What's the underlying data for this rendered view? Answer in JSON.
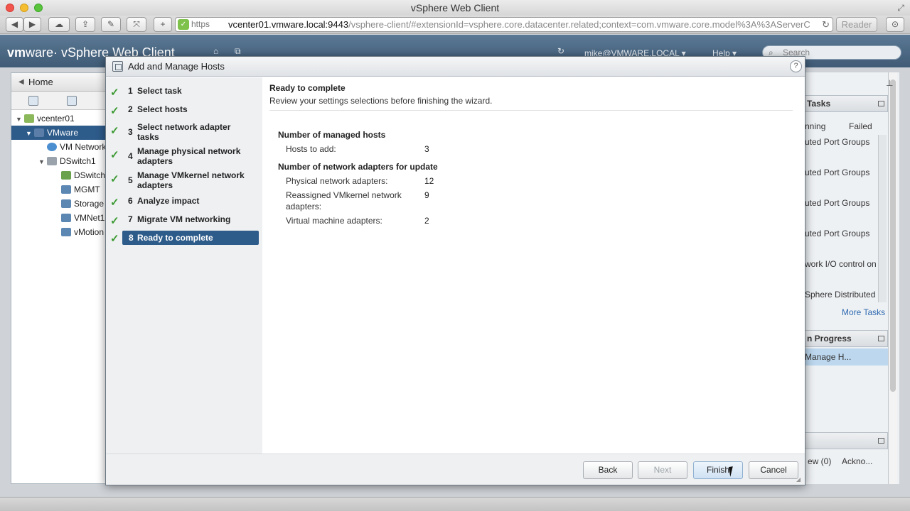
{
  "browser": {
    "window_title": "vSphere Web Client",
    "url_scheme": "https",
    "url_host": "vcenter01.vmware.local:9443",
    "url_path": "/vsphere-client/#extensionId=vsphere.core.datacenter.related;context=com.vmware.core.model%3A%3AServerC",
    "reader_label": "Reader"
  },
  "app": {
    "brand_vm": "vm",
    "brand_rest": "ware· vSphere Web Client",
    "user": "mike@VMWARE.LOCAL ▾",
    "help": "Help ▾",
    "search_placeholder": "Search"
  },
  "navigator": {
    "home_label": "Home",
    "tree": [
      {
        "label": "vcenter01",
        "level": 0
      },
      {
        "label": "VMware",
        "level": 1,
        "selected": true
      },
      {
        "label": "VM Network",
        "level": 2
      },
      {
        "label": "DSwitch1",
        "level": 2
      },
      {
        "label": "DSwitch",
        "level": 3
      },
      {
        "label": "MGMT",
        "level": 3
      },
      {
        "label": "Storage",
        "level": 3
      },
      {
        "label": "VMNet1",
        "level": 3
      },
      {
        "label": "vMotion",
        "level": 3
      }
    ]
  },
  "side_panel": {
    "tasks_title": "Tasks",
    "col_running": "nning",
    "col_failed": "Failed",
    "task_items": [
      "uted Port Groups",
      "uted Port Groups",
      "uted Port Groups",
      "uted Port Groups",
      "work I/O control on",
      "Sphere Distributed S"
    ],
    "more_tasks": "More Tasks",
    "progress_title": "n Progress",
    "progress_item": "Manage H...",
    "alarms_new": "ew (0)",
    "alarms_ack": "Ackno..."
  },
  "dialog": {
    "title": "Add and Manage Hosts",
    "help": "?",
    "steps": [
      {
        "num": "1",
        "label": "Select task"
      },
      {
        "num": "2",
        "label": "Select hosts"
      },
      {
        "num": "3",
        "label": "Select network adapter tasks"
      },
      {
        "num": "4",
        "label": "Manage physical network adapters"
      },
      {
        "num": "5",
        "label": "Manage VMkernel network adapters"
      },
      {
        "num": "6",
        "label": "Analyze impact"
      },
      {
        "num": "7",
        "label": "Migrate VM networking"
      },
      {
        "num": "8",
        "label": "Ready to complete"
      }
    ],
    "content_title": "Ready to complete",
    "content_subtitle": "Review your settings selections before finishing the wizard.",
    "section1_title": "Number of managed hosts",
    "hosts_to_add_label": "Hosts to add:",
    "hosts_to_add_value": "3",
    "section2_title": "Number of network adapters for update",
    "physical_label": "Physical network adapters:",
    "physical_value": "12",
    "vmkernel_label": "Reassigned VMkernel network adapters:",
    "vmkernel_value": "9",
    "vm_adapters_label": "Virtual machine adapters:",
    "vm_adapters_value": "2",
    "buttons": {
      "back": "Back",
      "next": "Next",
      "finish": "Finish",
      "cancel": "Cancel"
    }
  },
  "colors": {
    "selection_blue": "#2d5b8a",
    "check_green": "#3c9a32",
    "app_header": "#4a6784"
  }
}
